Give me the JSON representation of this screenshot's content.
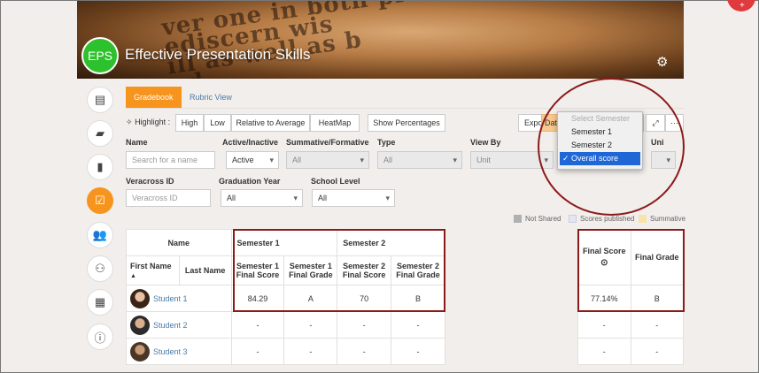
{
  "course": {
    "initials": "EPS",
    "title": "Effective Presentation Skills"
  },
  "banner_words": [
    "ver one   in both prose",
    "ediscern         wis",
    "ill as well as b",
    "nd",
    "ur"
  ],
  "tabs": [
    {
      "label": "Gradebook"
    },
    {
      "label": "Rubric View"
    }
  ],
  "highlight": {
    "label": "Highlight :",
    "options": [
      "High",
      "Low",
      "Relative to Average",
      "HeatMap"
    ],
    "show_percentages": "Show Percentages"
  },
  "toolbar": {
    "export_label": "Expo",
    "data_label": "Dat"
  },
  "filters": {
    "name": {
      "label": "Name",
      "placeholder": "Search for a name"
    },
    "active": {
      "label": "Active/Inactive",
      "value": "Active"
    },
    "summative": {
      "label": "Summative/Formative",
      "value": "All"
    },
    "type": {
      "label": "Type",
      "value": "All"
    },
    "view_by": {
      "label": "View By",
      "value": "Unit"
    },
    "unit": {
      "label": "Uni"
    },
    "veracross": {
      "label": "Veracross ID",
      "placeholder": "Veracross ID"
    },
    "grad_year": {
      "label": "Graduation Year",
      "value": "All"
    },
    "school_level": {
      "label": "School Level",
      "value": "All"
    }
  },
  "semester_dropdown": {
    "options": [
      "Select Semester",
      "Semester 1",
      "Semester 2",
      "✓ Overall score"
    ]
  },
  "legend": [
    {
      "label": "Not Shared",
      "color": "#b0b0b0"
    },
    {
      "label": "Scores published",
      "color": "#e6e6f2"
    },
    {
      "label": "Summative",
      "color": "#f8e3a8"
    }
  ],
  "table": {
    "name_header": "Name",
    "first_name": "First Name",
    "last_name": "Last Name",
    "sort_icon": "▲",
    "semester1": "Semester 1",
    "semester2": "Semester 2",
    "cols": [
      "Semester 1 Final Score",
      "Semester 1 Final Grade",
      "Semester 2 Final Score",
      "Semester 2 Final Grade"
    ],
    "final_score": "Final Score",
    "final_grade": "Final Grade",
    "rows": [
      {
        "name": "Student 1",
        "s1_score": "84.29",
        "s1_grade": "A",
        "s2_score": "70",
        "s2_grade": "B",
        "final_score": "77.14%",
        "final_grade": "B"
      },
      {
        "name": "Student 2",
        "s1_score": "-",
        "s1_grade": "-",
        "s2_score": "-",
        "s2_grade": "-",
        "final_score": "-",
        "final_grade": "-"
      },
      {
        "name": "Student 3",
        "s1_score": "-",
        "s1_grade": "-",
        "s2_score": "-",
        "s2_grade": "-",
        "final_score": "-",
        "final_grade": "-"
      }
    ]
  }
}
